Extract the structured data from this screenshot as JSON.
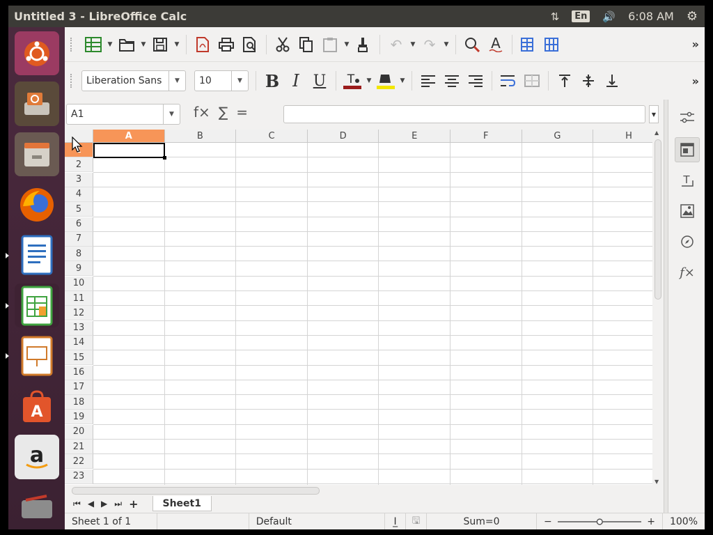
{
  "window": {
    "title": "Untitled 3 - LibreOffice Calc"
  },
  "panel": {
    "lang": "En",
    "clock": "6:08 AM"
  },
  "launcher": {
    "items": [
      {
        "name": "ubuntu-dash",
        "color": "#c04a7a"
      },
      {
        "name": "install-ubuntu",
        "color": "#8a6a52"
      },
      {
        "name": "files",
        "color": "#d7d2c8"
      },
      {
        "name": "firefox",
        "color": "#e66000"
      },
      {
        "name": "libreoffice-writer",
        "color": "#2e6fbf"
      },
      {
        "name": "libreoffice-calc",
        "color": "#3fa33f"
      },
      {
        "name": "libreoffice-impress",
        "color": "#d07a2a"
      },
      {
        "name": "ubuntu-software",
        "color": "#e2552b"
      },
      {
        "name": "amazon",
        "color": "#f2f2f2"
      },
      {
        "name": "system-settings",
        "color": "#8c8c8c"
      }
    ]
  },
  "toolbar2": {
    "font_name": "Liberation Sans",
    "font_size": "10"
  },
  "formula_bar": {
    "name_box": "A1",
    "fx": "f×",
    "sigma": "∑",
    "equals": "="
  },
  "grid": {
    "columns": [
      "A",
      "B",
      "C",
      "D",
      "E",
      "F",
      "G",
      "H"
    ],
    "rows": [
      "1",
      "2",
      "3",
      "4",
      "5",
      "6",
      "7",
      "8",
      "9",
      "10",
      "11",
      "12",
      "13",
      "14",
      "15",
      "16",
      "17",
      "18",
      "19",
      "20",
      "21",
      "22",
      "23"
    ],
    "active_cell": "A1"
  },
  "tabs": {
    "sheet_name": "Sheet1"
  },
  "status": {
    "sheet": "Sheet 1 of 1",
    "style": "Default",
    "sum": "Sum=0",
    "zoom": "100%"
  },
  "colors": {
    "accent_header": "#f79558",
    "panel": "#3c3b37",
    "font_color_bar": "#9b1c1c",
    "highlight_bar": "#f2e600"
  }
}
